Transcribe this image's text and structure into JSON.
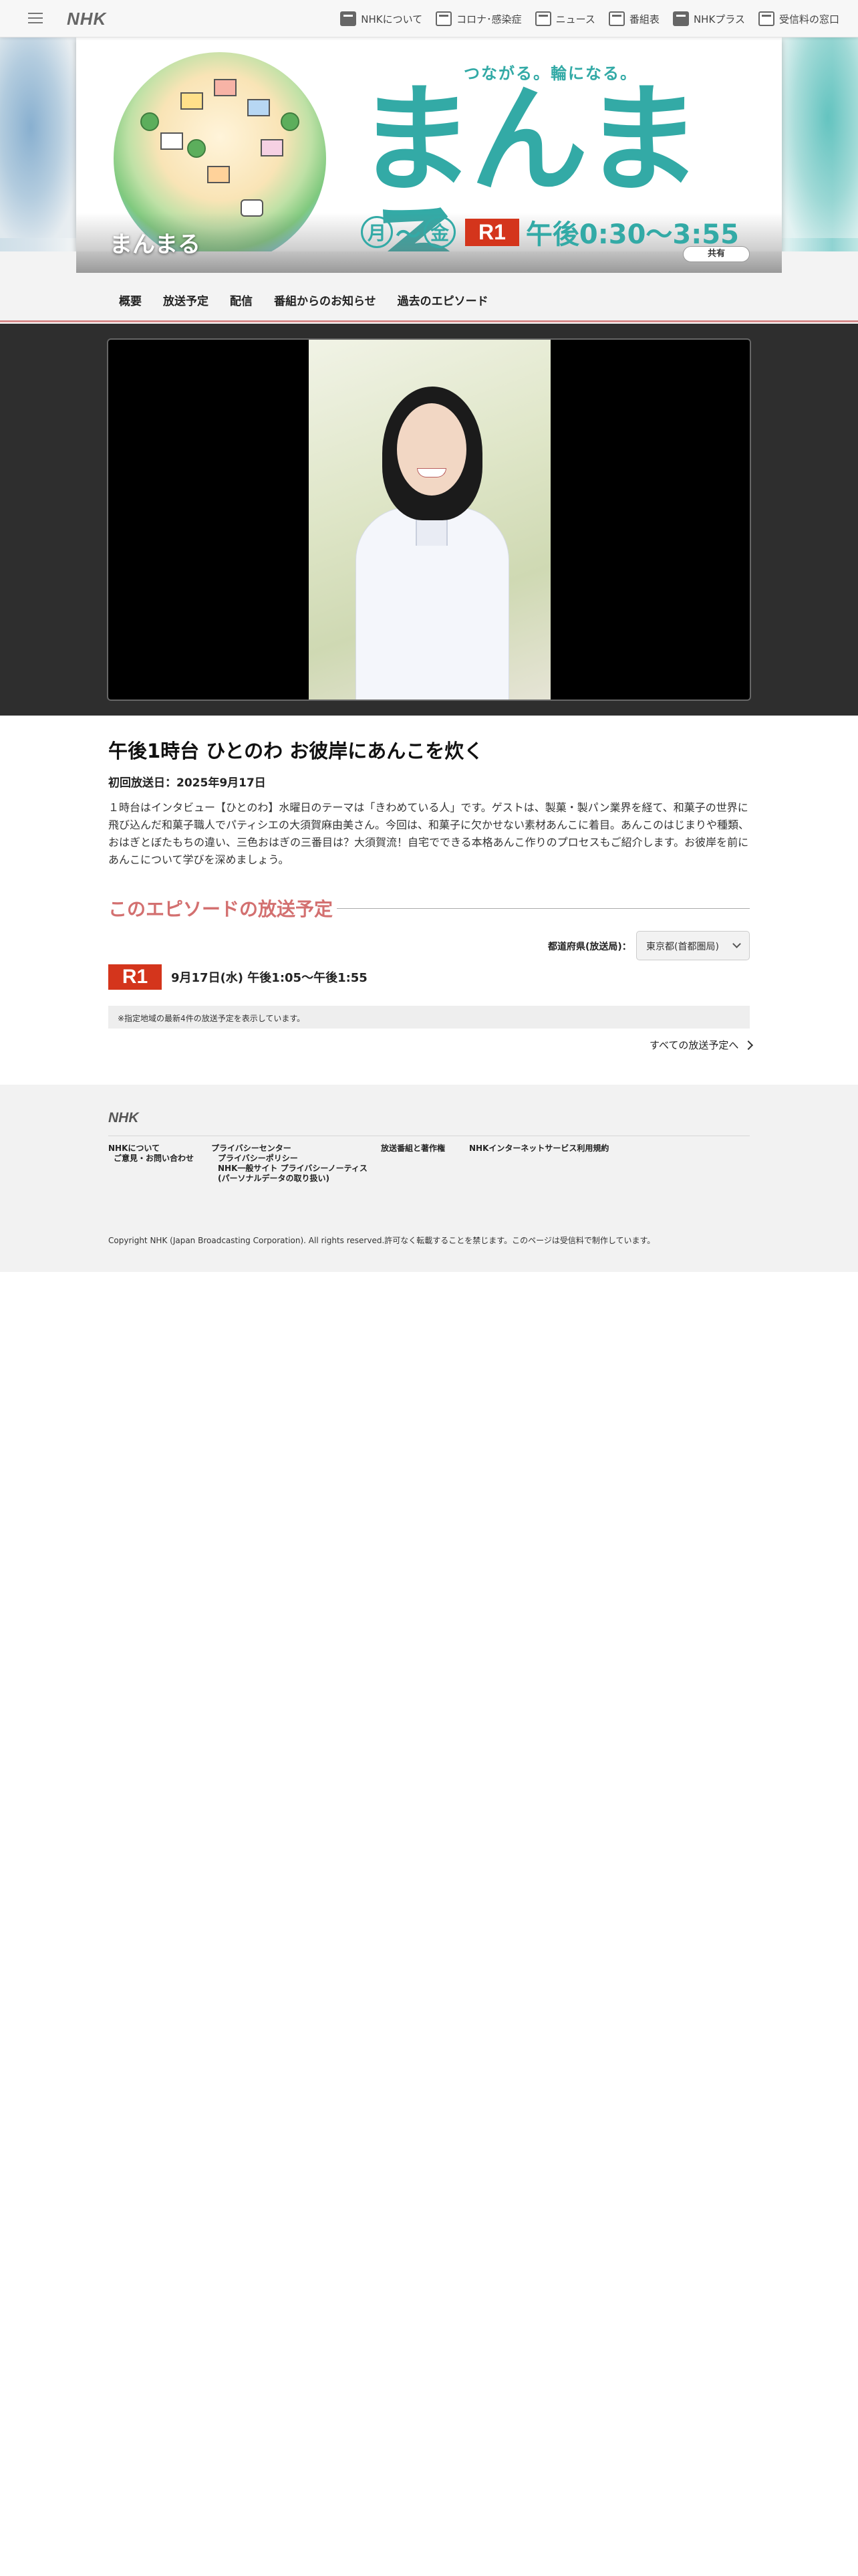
{
  "topbar": {
    "logo": "NHK",
    "links": [
      "NHKについて",
      "コロナ･感染症",
      "ニュース",
      "番組表",
      "NHKプラス",
      "受信料の窓口"
    ]
  },
  "hero": {
    "tagline": "つながる。輪になる。",
    "logo_text": "まんまる",
    "show_title": "まんまる",
    "day_start": "月",
    "day_tilde": "〜",
    "day_end": "金",
    "channel": "R1",
    "time": "午後0:30〜3:55",
    "share_label": "共有"
  },
  "program_nav": [
    "概要",
    "放送予定",
    "配信",
    "番組からのお知らせ",
    "過去のエピソード"
  ],
  "episode": {
    "title": "午後1時台 ひとのわ お彼岸にあんこを炊く",
    "first_air": "初回放送日：2025年9月17日",
    "description": "１時台はインタビュー【ひとのわ】水曜日のテーマは「きわめている人」です。ゲストは、製菓・製パン業界を経て、和菓子の世界に飛び込んだ和菓子職人でパティシエの大須賀麻由美さん。今回は、和菓子に欠かせない素材あんこに着目。あんこのはじまりや種類、おはぎとぼたもちの違い、三色おはぎの三番目は？大須賀流！自宅でできる本格あんこ作りのプロセスもご紹介します。お彼岸を前にあんこについて学びを深めましょう。"
  },
  "schedule": {
    "heading": "このエピソードの放送予定",
    "pref_label": "都道府県(放送局)：",
    "pref_value": "東京都(首都圏局)",
    "channel": "R1",
    "air_time": "9月17日(水) 午後1:05〜午後1:55",
    "notice": "※指定地域の最新4件の放送予定を表示しています。",
    "all_link": "すべての放送予定へ"
  },
  "footer": {
    "logo": "NHK",
    "col1": [
      "NHKについて",
      "ご意見・お問い合わせ"
    ],
    "col2": [
      "プライバシーセンター",
      "プライバシーポリシー",
      "NHK一般サイト プライバシーノーティス",
      "(パーソナルデータの取り扱い)"
    ],
    "col3": [
      "放送番組と著作権"
    ],
    "col4": [
      "NHKインターネットサービス利用規約"
    ],
    "copyright": "Copyright NHK (Japan Broadcasting Corporation). All rights reserved.許可なく転載することを禁じます。このページは受信料で制作しています。"
  },
  "colors": {
    "brand_teal": "#33aaa6",
    "r1_red": "#d4351c",
    "section_pink": "#d37070"
  },
  "icons": [
    "hamburger-menu-icon",
    "nhk-about-icon",
    "corona-icon",
    "news-icon",
    "program-table-icon",
    "nhk-plus-icon",
    "receiving-fee-icon",
    "chevron-down-icon",
    "chevron-right-icon"
  ]
}
